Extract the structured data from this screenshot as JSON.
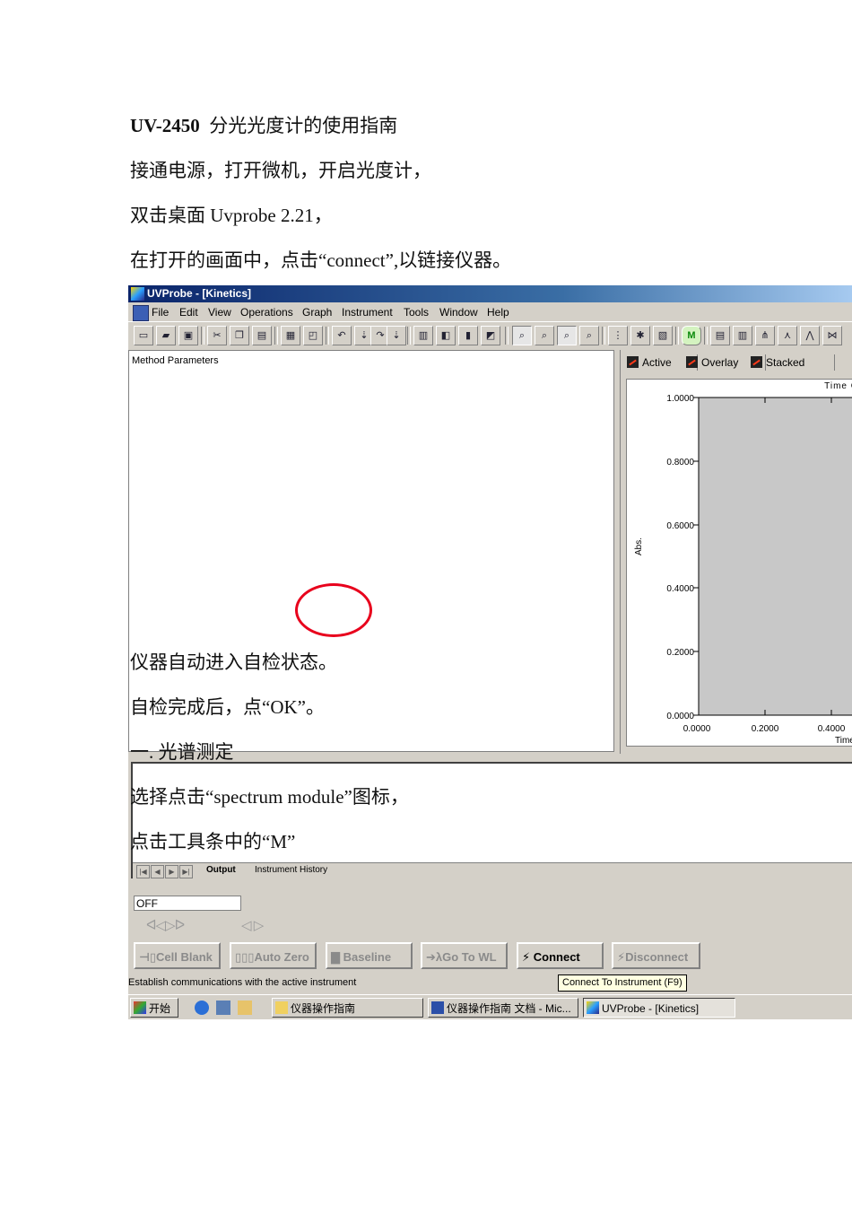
{
  "doc": {
    "title_model": "UV-2450",
    "title_text": "分光光度计的使用指南",
    "line1": "接通电源，打开微机，开启光度计，",
    "line2": "双击桌面 Uvprobe 2.21，",
    "line3": "在打开的画面中，点击“connect”,以链接仪器。",
    "line4": "仪器自动进入自检状态。",
    "line5": "自检完成后，点“OK”。",
    "line6": "一.   光谱测定",
    "line7": "选择点击“spectrum module”图标，",
    "line8": "点击工具条中的“M”"
  },
  "app": {
    "title": "UVProbe - [Kinetics]",
    "menus": [
      "File",
      "Edit",
      "View",
      "Operations",
      "Graph",
      "Instrument",
      "Tools",
      "Window",
      "Help"
    ],
    "method_label": "Method Parameters",
    "tabs": [
      "Active",
      "Overlay",
      "Stacked"
    ],
    "graph": {
      "ylabel": "Abs.",
      "xlabel": "Time",
      "title": "Time C",
      "y_ticks": [
        "1.0000",
        "0.8000",
        "0.6000",
        "0.4000",
        "0.2000",
        "0.0000"
      ],
      "x_ticks": [
        "0.0000",
        "0.2000",
        "0.4000"
      ]
    },
    "output_tabs": [
      "Output",
      "Instrument History"
    ],
    "status_value": "OFF",
    "buttons": [
      "Cell Blank",
      "Auto Zero",
      "Baseline",
      "Go To WL",
      "Connect",
      "Disconnect"
    ],
    "tooltip": "Connect To Instrument (F9)",
    "statusbar": "Establish communications with the active instrument",
    "taskbar": {
      "start": "开始",
      "tasks": [
        "仪器操作指南",
        "仪器操作指南 文档 - Mic...",
        "UVProbe - [Kinetics]"
      ]
    },
    "colors": {
      "plot_fill": "#c8c8c8",
      "title_bar": "#0a246a",
      "highlight_circle": "#e8001c"
    }
  }
}
